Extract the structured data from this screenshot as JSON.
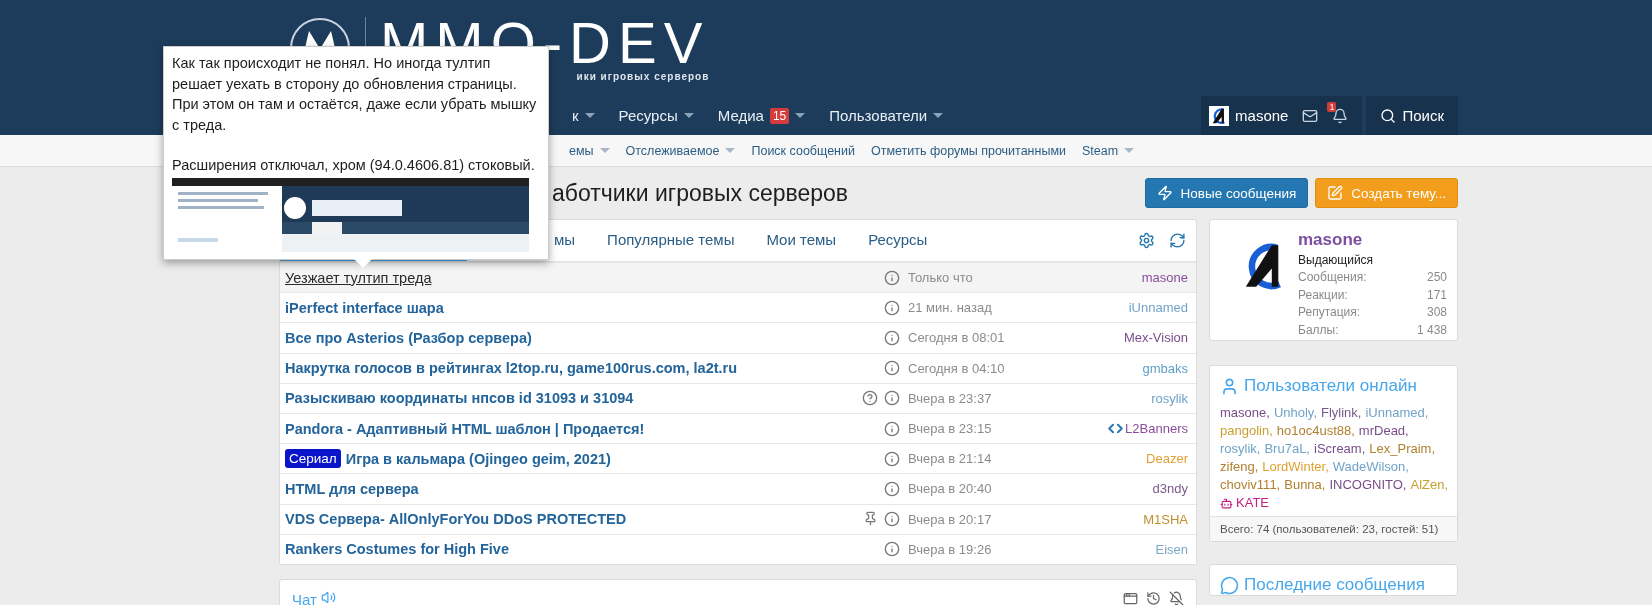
{
  "header": {
    "logo_title": "MMO-DEV",
    "logo_subtitle": "ики игровых серверов",
    "nav": [
      {
        "label": "к",
        "caret": true
      },
      {
        "label": "Ресурсы",
        "caret": true
      },
      {
        "label": "Медиа",
        "badge": "15",
        "caret": true
      },
      {
        "label": "Пользователи",
        "caret": true
      }
    ],
    "user": {
      "name": "masone",
      "notifications_badge": "1"
    },
    "search": "Поиск"
  },
  "subnav": [
    {
      "label": "емы",
      "caret": true
    },
    {
      "label": "Отслеживаемое",
      "caret": true
    },
    {
      "label": "Поиск сообщений",
      "caret": false
    },
    {
      "label": "Отметить форумы прочитанными",
      "caret": false
    },
    {
      "label": "Steam",
      "caret": true
    }
  ],
  "page_title": "аботчики игровых серверов",
  "buttons": [
    {
      "label": "Новые сообщения",
      "kind": "new"
    },
    {
      "label": "Создать тему...",
      "kind": "create"
    }
  ],
  "tooltip": {
    "paragraphs": [
      "Как так происходит не понял. Но иногда тултип решает уехать в сторону до обновления страницы. При этом он там и остаётся, даже если убрать мышку с треда.",
      "Расширения отключал, хром (94.0.4606.81) стоковый."
    ]
  },
  "tabs": [
    {
      "selected": true
    },
    {
      "label": "мы",
      "selected": false
    },
    {
      "label": "Популярные темы",
      "selected": false
    },
    {
      "label": "Мои темы",
      "selected": false
    },
    {
      "label": "Ресурсы",
      "selected": false
    }
  ],
  "threads": [
    {
      "title": "Уезжает тултип треда",
      "unread": false,
      "question": false,
      "pinned": false,
      "time": "Только что",
      "author": "masone",
      "color": "#8a4d9e"
    },
    {
      "title": "iPerfect interface шара",
      "unread": true,
      "question": false,
      "pinned": false,
      "time": "21 мин. назад",
      "author": "iUnnamed",
      "color": "#6fa3c8"
    },
    {
      "title": "Все про Asterios (Разбор сервера)",
      "unread": true,
      "question": false,
      "pinned": false,
      "time": "Сегодня в 08:01",
      "author": "Mex-Vision",
      "color": "#7a4d8a"
    },
    {
      "title": "Накрутка голосов в рейтингах l2top.ru, game100rus.com, la2t.ru",
      "unread": true,
      "question": false,
      "pinned": false,
      "time": "Сегодня в 04:10",
      "author": "gmbaks",
      "color": "#5fa0c4"
    },
    {
      "title": "Разыскиваю координаты нпсов id 31093 и 31094",
      "unread": true,
      "question": true,
      "pinned": false,
      "time": "Вчера в 23:37",
      "author": "rosylik",
      "color": "#6fa3c8"
    },
    {
      "title": "Pandora - Адаптивный HTML шаблон | Продается!",
      "unread": true,
      "question": false,
      "pinned": false,
      "time": "Вчера в 23:15",
      "author": "L2Banners",
      "code_icon": true,
      "color": "#8a4d9e"
    },
    {
      "title": "Игра в кальмара (Ojingeo geim, 2021)",
      "prefix": "Сериал",
      "unread": true,
      "question": false,
      "pinned": false,
      "time": "Вчера в 21:14",
      "author": "Deazer",
      "color": "#e0a030"
    },
    {
      "title": "HTML для сервера",
      "unread": true,
      "question": false,
      "pinned": false,
      "time": "Вчера в 20:40",
      "author": "d3ndy",
      "color": "#7a5a8a"
    },
    {
      "title": "VDS Сервера- AllOnlyForYou DDoS PROTECTED",
      "unread": true,
      "question": false,
      "pinned": true,
      "time": "Вчера в 20:17",
      "author": "M1SHA",
      "color": "#c09030"
    },
    {
      "title": "Rankers Costumes for High Five",
      "unread": true,
      "question": false,
      "pinned": false,
      "time": "Вчера в 19:26",
      "author": "Eisen",
      "color": "#7aa8c8"
    }
  ],
  "chat": {
    "title": "Чат"
  },
  "profile": {
    "name": "masone",
    "rank": "Выдающийся",
    "stats": [
      {
        "label": "Сообщения:",
        "value": "250"
      },
      {
        "label": "Реакции:",
        "value": "171"
      },
      {
        "label": "Репутация:",
        "value": "308"
      },
      {
        "label": "Баллы:",
        "value": "1 438"
      }
    ]
  },
  "online": {
    "title": "Пользователи онлайн",
    "users": [
      {
        "name": "masone,",
        "color": "#7a4d8a"
      },
      {
        "name": "Unholy,",
        "color": "#6fa3c8"
      },
      {
        "name": "Flylink,",
        "color": "#7a5a8a"
      },
      {
        "name": "iUnnamed,",
        "color": "#6fa3c8"
      },
      {
        "name": "pangolin,",
        "color": "#c8a030"
      },
      {
        "name": "ho1oc4ust88,",
        "color": "#b08030"
      },
      {
        "name": "mrDead,",
        "color": "#7a4d8a"
      },
      {
        "name": "rosylik,",
        "color": "#6fa3c8"
      },
      {
        "name": "Bru7aL,",
        "color": "#6fa3c8"
      },
      {
        "name": "iScream,",
        "color": "#7a4d8a"
      },
      {
        "name": "Lex_Praim,",
        "color": "#b08030"
      },
      {
        "name": "zifeng,",
        "color": "#b08030"
      },
      {
        "name": "LordWinter,",
        "color": "#e0a030"
      },
      {
        "name": "WadeWilson,",
        "color": "#6fa3c8"
      },
      {
        "name": "choviv111,",
        "color": "#b08030"
      },
      {
        "name": "Bunna,",
        "color": "#b08030"
      },
      {
        "name": "INCOGNITO,",
        "color": "#7a4d8a"
      },
      {
        "name": "AlZen,",
        "color": "#c8a030"
      },
      {
        "name": "KATE",
        "color": "#c02080",
        "bot": true
      }
    ],
    "footer": "Всего: 74 (пользователей: 23, гостей: 51)"
  },
  "latest": {
    "title": "Последние сообщения"
  }
}
